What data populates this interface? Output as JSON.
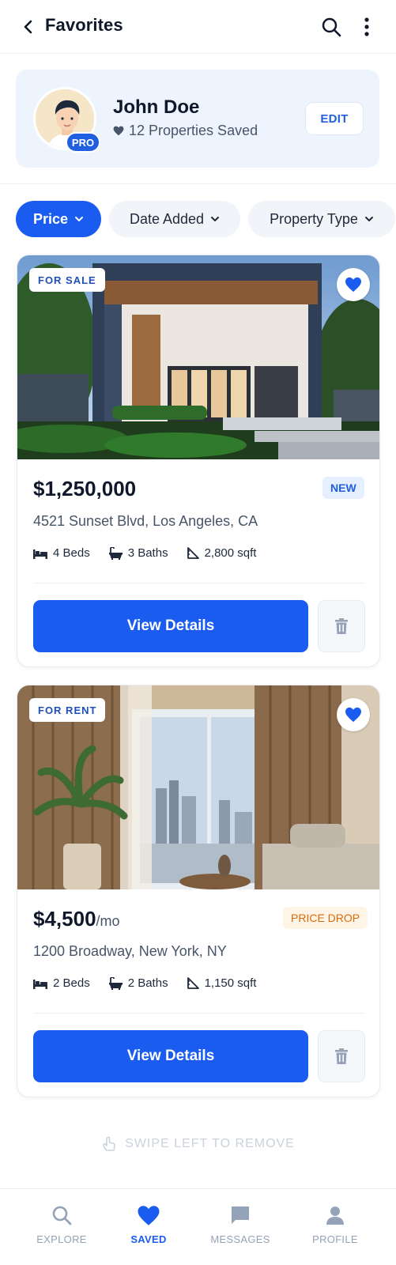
{
  "header": {
    "title": "Favorites",
    "back_icon": "chevron-left-icon",
    "search_icon": "search-icon",
    "more_icon": "more-vertical-icon"
  },
  "profile": {
    "name": "John Doe",
    "saved_count_text": "12 Properties Saved",
    "badge": "PRO",
    "edit_label": "EDIT"
  },
  "filters": [
    {
      "label": "Price",
      "active": true
    },
    {
      "label": "Date Added",
      "active": false
    },
    {
      "label": "Property Type",
      "active": false
    }
  ],
  "listings": [
    {
      "tag": "FOR SALE",
      "price": "$1,250,000",
      "price_unit": "",
      "badge": "NEW",
      "address": "4521 Sunset Blvd, Los Angeles, CA",
      "beds": "4 Beds",
      "baths": "3 Baths",
      "area": "2,800 sqft",
      "cta": "View Details",
      "favorited": true
    },
    {
      "tag": "FOR RENT",
      "price": "$4,500",
      "price_unit": "/mo",
      "badge": "PRICE DROP",
      "address": "1200 Broadway, New York, NY",
      "beds": "2 Beds",
      "baths": "2 Baths",
      "area": "1,150 sqft",
      "cta": "View Details",
      "favorited": true
    }
  ],
  "swipe_hint": "SWIPE LEFT TO REMOVE",
  "nav": [
    {
      "label": "EXPLORE",
      "icon": "search-icon",
      "active": false
    },
    {
      "label": "SAVED",
      "icon": "heart-icon",
      "active": true
    },
    {
      "label": "MESSAGES",
      "icon": "message-icon",
      "active": false
    },
    {
      "label": "PROFILE",
      "icon": "person-icon",
      "active": false
    }
  ],
  "colors": {
    "primary": "#1a5cf0",
    "profile_bg": "#eef4fd",
    "chip_bg": "#f1f4f8",
    "new_badge_bg": "#e6efff",
    "price_drop_text": "#d86a0a",
    "muted_text": "#94a3b8"
  }
}
